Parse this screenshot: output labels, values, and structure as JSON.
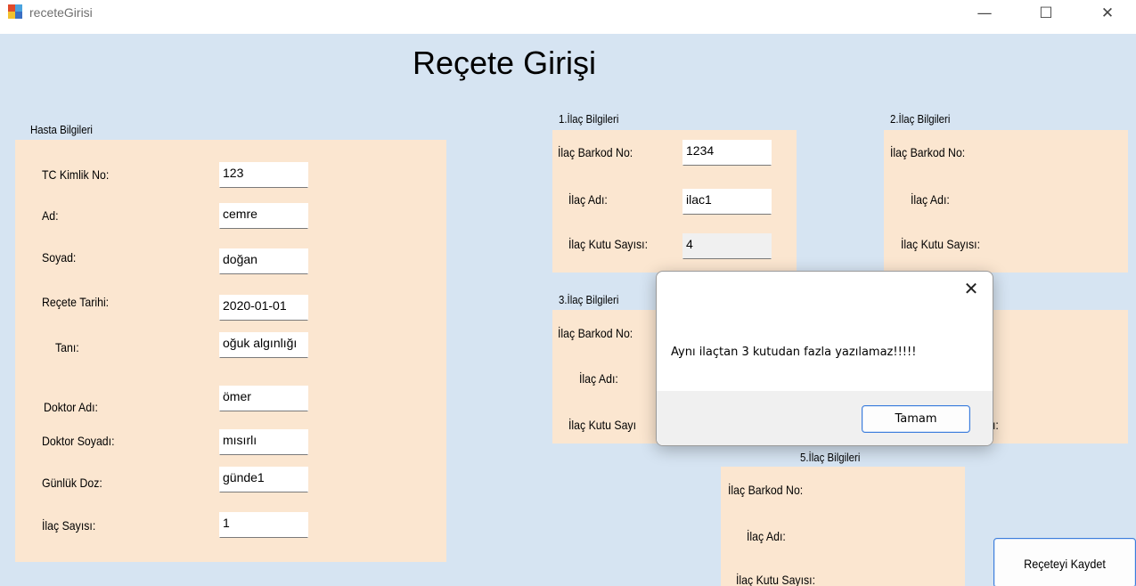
{
  "window": {
    "title": "receteGirisi",
    "minimize_glyph": "—",
    "maximize_glyph": "☐",
    "close_glyph": "✕",
    "icon": "windows-form-icon"
  },
  "main_title": "Reçete Girişi",
  "patient": {
    "group_label": "Hasta Bilgileri",
    "fields": [
      {
        "label": "TC Kimlik No:",
        "value": "123"
      },
      {
        "label": "Ad:",
        "value": "cemre"
      },
      {
        "label": "Soyad:",
        "value": "doğan"
      },
      {
        "label": "Reçete Tarihi:",
        "value": "2020-01-01"
      },
      {
        "label": "Tanı:",
        "value": "oğuk algınlığı"
      },
      {
        "label": "Doktor Adı:",
        "value": "ömer"
      },
      {
        "label": "Doktor Soyadı:",
        "value": "mısırlı"
      },
      {
        "label": "Günlük Doz:",
        "value": "günde1"
      },
      {
        "label": "İlaç Sayısı:",
        "value": "1"
      }
    ]
  },
  "drugs": {
    "barcode_label": "İlaç Barkod No:",
    "name_label": "İlaç Adı:",
    "box_label": "İlaç Kutu Sayısı:",
    "groups": [
      {
        "label": "1.İlaç Bilgileri",
        "barcode": "1234",
        "name": "ilac1",
        "boxes": "4"
      },
      {
        "label": "2.İlaç Bilgileri"
      },
      {
        "label": "3.İlaç Bilgileri"
      },
      {
        "label": "5.İlaç Bilgileri"
      }
    ],
    "group3_box_label_visible": "İlaç Kutu Sayı",
    "group4_box_label_fragment": "ı:"
  },
  "save_button": "Reçeteyi Kaydet",
  "dialog": {
    "message": "Aynı ilaçtan 3 kutudan fazla yazılamaz!!!!!",
    "ok_label": "Tamam",
    "close_glyph": "✕"
  },
  "colors": {
    "client_bg": "#d6e4f2",
    "panel_bg": "#fbe6d0",
    "button_border": "#3c7ddc"
  }
}
